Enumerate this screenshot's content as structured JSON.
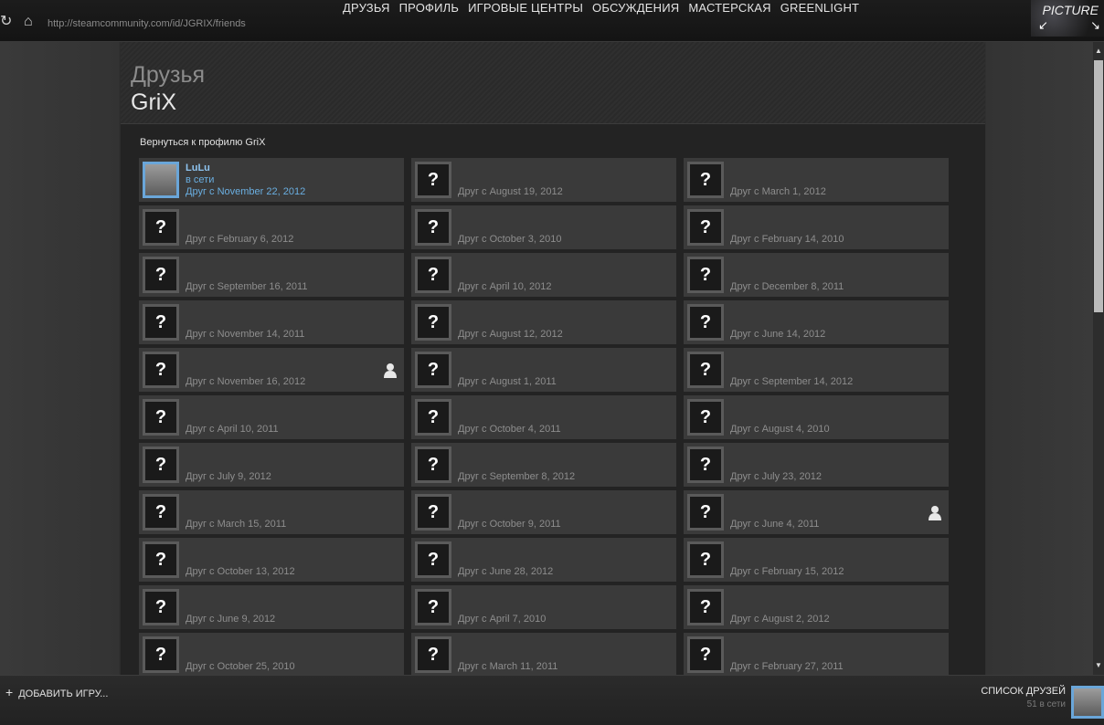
{
  "browser": {
    "url": "http://steamcommunity.com/id/JGRIX/friends"
  },
  "menu": [
    "ДРУЗЬЯ",
    "ПРОФИЛЬ",
    "ИГРОВЫЕ ЦЕНТРЫ",
    "ОБСУЖДЕНИЯ",
    "МАСТЕРСКАЯ",
    "GREENLIGHT"
  ],
  "pip": {
    "label": "PICTURE"
  },
  "header": {
    "subtitle": "Друзья",
    "name": "GriX"
  },
  "back_link": "Вернуться к профилю GriX",
  "friends": [
    {
      "name": "LuLu",
      "status": "в сети",
      "since": "Друг с November 22, 2012",
      "online": true,
      "icon": false
    },
    {
      "name": "",
      "status": "",
      "since": "Друг с August 19, 2012",
      "online": false,
      "icon": false
    },
    {
      "name": "",
      "status": "",
      "since": "Друг с March 1, 2012",
      "online": false,
      "icon": false
    },
    {
      "name": "",
      "status": "",
      "since": "Друг с February 6, 2012",
      "online": false,
      "icon": false
    },
    {
      "name": "",
      "status": "",
      "since": "Друг с October 3, 2010",
      "online": false,
      "icon": false
    },
    {
      "name": "",
      "status": "",
      "since": "Друг с February 14, 2010",
      "online": false,
      "icon": false
    },
    {
      "name": "",
      "status": "",
      "since": "Друг с September 16, 2011",
      "online": false,
      "icon": false
    },
    {
      "name": "",
      "status": "",
      "since": "Друг с April 10, 2012",
      "online": false,
      "icon": false
    },
    {
      "name": "",
      "status": "",
      "since": "Друг с December 8, 2011",
      "online": false,
      "icon": false
    },
    {
      "name": "",
      "status": "",
      "since": "Друг с November 14, 2011",
      "online": false,
      "icon": false
    },
    {
      "name": "",
      "status": "",
      "since": "Друг с August 12, 2012",
      "online": false,
      "icon": false
    },
    {
      "name": "",
      "status": "",
      "since": "Друг с June 14, 2012",
      "online": false,
      "icon": false
    },
    {
      "name": "",
      "status": "",
      "since": "Друг с November 16, 2012",
      "online": false,
      "icon": true
    },
    {
      "name": "",
      "status": "",
      "since": "Друг с August 1, 2011",
      "online": false,
      "icon": false
    },
    {
      "name": "",
      "status": "",
      "since": "Друг с September 14, 2012",
      "online": false,
      "icon": false
    },
    {
      "name": "",
      "status": "",
      "since": "Друг с April 10, 2011",
      "online": false,
      "icon": false
    },
    {
      "name": "",
      "status": "",
      "since": "Друг с October 4, 2011",
      "online": false,
      "icon": false
    },
    {
      "name": "",
      "status": "",
      "since": "Друг с August 4, 2010",
      "online": false,
      "icon": false
    },
    {
      "name": "",
      "status": "",
      "since": "Друг с July 9, 2012",
      "online": false,
      "icon": false
    },
    {
      "name": "",
      "status": "",
      "since": "Друг с September 8, 2012",
      "online": false,
      "icon": false
    },
    {
      "name": "",
      "status": "",
      "since": "Друг с July 23, 2012",
      "online": false,
      "icon": false
    },
    {
      "name": "",
      "status": "",
      "since": "Друг с March 15, 2011",
      "online": false,
      "icon": false
    },
    {
      "name": "",
      "status": "",
      "since": "Друг с October 9, 2011",
      "online": false,
      "icon": false
    },
    {
      "name": "",
      "status": "",
      "since": "Друг с June 4, 2011",
      "online": false,
      "icon": true
    },
    {
      "name": "",
      "status": "",
      "since": "Друг с October 13, 2012",
      "online": false,
      "icon": false
    },
    {
      "name": "",
      "status": "",
      "since": "Друг с June 28, 2012",
      "online": false,
      "icon": false
    },
    {
      "name": "",
      "status": "",
      "since": "Друг с February 15, 2012",
      "online": false,
      "icon": false
    },
    {
      "name": "",
      "status": "",
      "since": "Друг с June 9, 2012",
      "online": false,
      "icon": false
    },
    {
      "name": "",
      "status": "",
      "since": "Друг с April 7, 2010",
      "online": false,
      "icon": false
    },
    {
      "name": "",
      "status": "",
      "since": "Друг с August 2, 2012",
      "online": false,
      "icon": false
    },
    {
      "name": "",
      "status": "",
      "since": "Друг с October 25, 2010",
      "online": false,
      "icon": false
    },
    {
      "name": "",
      "status": "",
      "since": "Друг с March 11, 2011",
      "online": false,
      "icon": false
    },
    {
      "name": "",
      "status": "",
      "since": "Друг с February 27, 2011",
      "online": false,
      "icon": false
    }
  ],
  "bottom": {
    "add_game": "ДОБАВИТЬ ИГРУ...",
    "friends_list": "СПИСОК ДРУЗЕЙ",
    "online_count": "51 в сети"
  }
}
